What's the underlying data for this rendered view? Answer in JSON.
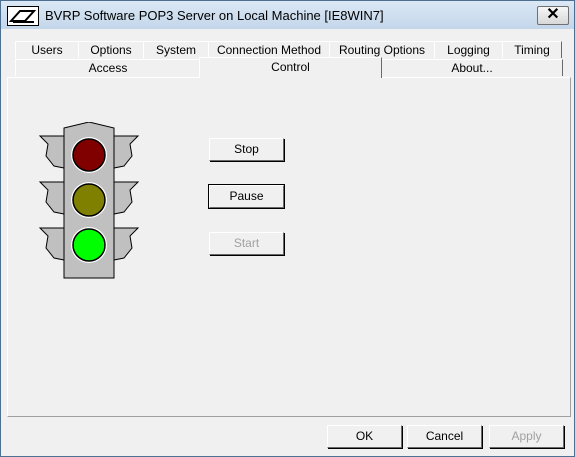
{
  "window": {
    "title": "BVRP Software POP3 Server on Local Machine [IE8WIN7]",
    "close_label": "✕"
  },
  "tabs_row1": [
    {
      "label": "Users"
    },
    {
      "label": "Options"
    },
    {
      "label": "System"
    },
    {
      "label": "Connection Method"
    },
    {
      "label": "Routing Options"
    },
    {
      "label": "Logging"
    },
    {
      "label": "Timing"
    }
  ],
  "tabs_row2": [
    {
      "label": "Access"
    },
    {
      "label": "Control"
    },
    {
      "label": "About..."
    }
  ],
  "active_tab": "Control",
  "traffic_light": {
    "colors": {
      "red": "#800000",
      "yellow": "#808000",
      "green": "#00ff00",
      "body": "#c0c0c0"
    }
  },
  "control_buttons": {
    "stop": "Stop",
    "pause": "Pause",
    "start": "Start"
  },
  "footer": {
    "ok": "OK",
    "cancel": "Cancel",
    "apply": "Apply"
  }
}
